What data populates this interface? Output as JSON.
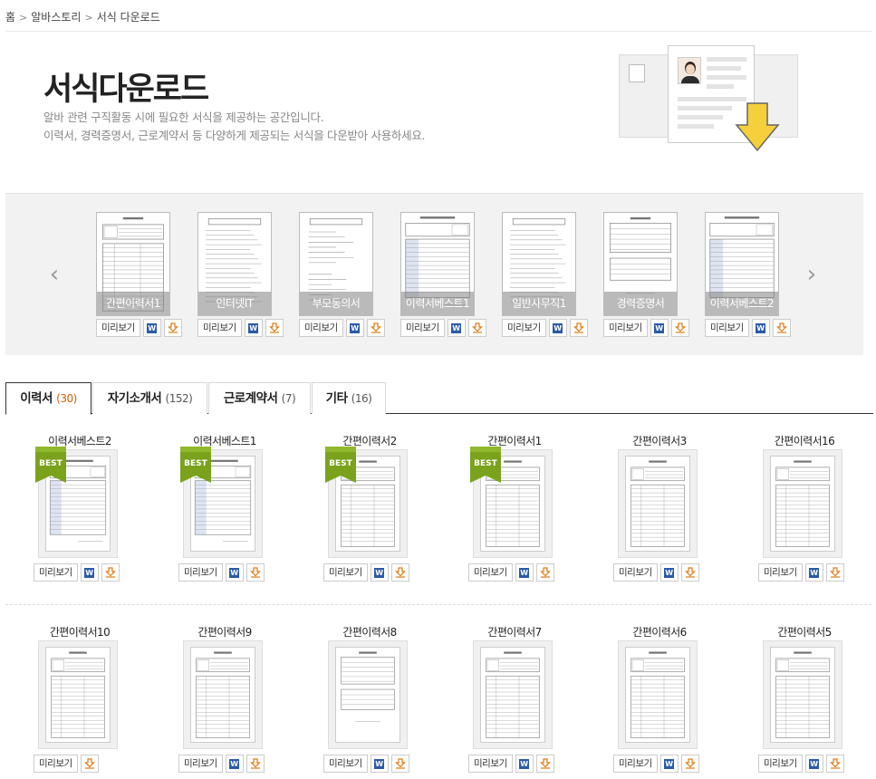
{
  "breadcrumb": {
    "home": "홈",
    "section": "알바스토리",
    "current": "서식 다운로드",
    "sep": ">"
  },
  "header": {
    "title": "서식다운로드",
    "desc_line1": "알바 관련 구직활동 시에 필요한 서식을 제공하는 공간입니다.",
    "desc_line2": "이력서, 경력증명서, 근로계약서 등 다양하게 제공되는 서식을 다운받아 사용하세요."
  },
  "buttons": {
    "preview": "미리보기",
    "word": "W"
  },
  "carousel": {
    "prev": "‹",
    "next": "›",
    "items": [
      {
        "label": "간편이력서1",
        "doc": "A"
      },
      {
        "label": "인터넷IT",
        "doc": "D"
      },
      {
        "label": "부모동의서",
        "doc": "C"
      },
      {
        "label": "이력서베스트1",
        "doc": "B"
      },
      {
        "label": "일반사무직1",
        "doc": "D"
      },
      {
        "label": "경력증명서",
        "doc": "E"
      },
      {
        "label": "이력서베스트2",
        "doc": "B"
      }
    ]
  },
  "tabs": [
    {
      "label": "이력서",
      "count": "(30)",
      "active": true
    },
    {
      "label": "자기소개서",
      "count": "(152)",
      "active": false
    },
    {
      "label": "근로계약서",
      "count": "(7)",
      "active": false
    },
    {
      "label": "기타",
      "count": "(16)",
      "active": false
    }
  ],
  "badge_text": "BEST",
  "grid_rows": [
    [
      {
        "title": "이력서베스트2",
        "best": true,
        "word": true,
        "doc": "B"
      },
      {
        "title": "이력서베스트1",
        "best": true,
        "word": true,
        "doc": "B"
      },
      {
        "title": "간편이력서2",
        "best": true,
        "word": true,
        "doc": "A"
      },
      {
        "title": "간편이력서1",
        "best": true,
        "word": true,
        "doc": "A"
      },
      {
        "title": "간편이력서3",
        "best": false,
        "word": true,
        "doc": "A"
      },
      {
        "title": "간편이력서16",
        "best": false,
        "word": true,
        "doc": "A"
      }
    ],
    [
      {
        "title": "간편이력서10",
        "best": false,
        "word": false,
        "doc": "A"
      },
      {
        "title": "간편이력서9",
        "best": false,
        "word": true,
        "doc": "A"
      },
      {
        "title": "간편이력서8",
        "best": false,
        "word": true,
        "doc": "E"
      },
      {
        "title": "간편이력서7",
        "best": false,
        "word": true,
        "doc": "A"
      },
      {
        "title": "간편이력서6",
        "best": false,
        "word": true,
        "doc": "A"
      },
      {
        "title": "간편이력서5",
        "best": false,
        "word": true,
        "doc": "A"
      }
    ]
  ],
  "colors": {
    "accent": "#e05a00",
    "word_icon": "#2a5aa8",
    "download_icon": "#e07a10",
    "badge": "#7aa21c",
    "hero_arrow": "#f6d03a"
  }
}
